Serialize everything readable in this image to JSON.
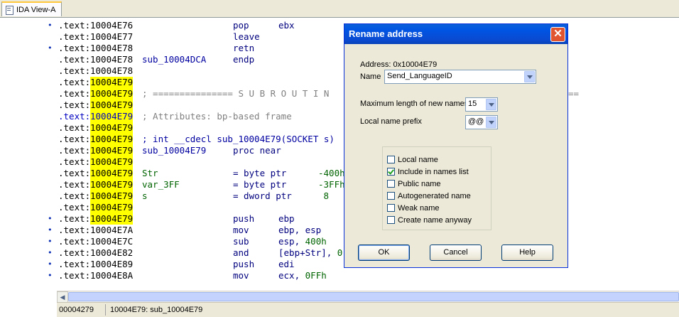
{
  "tab": {
    "title": "IDA View-A"
  },
  "listing": {
    "rows": [
      {
        "bullet": true,
        "seg": ".text:",
        "addr": "10004E76",
        "hl": false,
        "label": "",
        "op": "pop",
        "operand": "ebx",
        "comment": ""
      },
      {
        "bullet": false,
        "seg": ".text:",
        "addr": "10004E77",
        "hl": false,
        "label": "",
        "op": "leave",
        "operand": "",
        "comment": ""
      },
      {
        "bullet": true,
        "seg": ".text:",
        "addr": "10004E78",
        "hl": false,
        "label": "",
        "op": "retn",
        "operand": "",
        "comment": ""
      },
      {
        "bullet": false,
        "seg": ".text:",
        "addr": "10004E78",
        "hl": false,
        "label": "sub_10004DCA",
        "op": "endp",
        "operand": "",
        "comment": ""
      },
      {
        "bullet": false,
        "seg": ".text:",
        "addr": "10004E78",
        "hl": false,
        "label": "",
        "op": "",
        "operand": "",
        "comment": ""
      },
      {
        "bullet": false,
        "seg": ".text:",
        "addr": "10004E79",
        "hl": true,
        "label": "",
        "op": "",
        "operand": "",
        "comment": ""
      },
      {
        "bullet": false,
        "seg": ".text:",
        "addr": "10004E79",
        "hl": true,
        "label": "",
        "op": "",
        "operand": "",
        "comment": "; =============== S U B R O U T I N"
      },
      {
        "bullet": false,
        "seg": ".text:",
        "addr": "10004E79",
        "hl": true,
        "label": "",
        "op": "",
        "operand": "",
        "comment": ""
      },
      {
        "bullet": false,
        "seg": ".text:",
        "addr": "10004E79",
        "hl": true,
        "label": "",
        "op": "",
        "operand": "",
        "comment": "; Attributes: bp-based frame",
        "segblue": true
      },
      {
        "bullet": false,
        "seg": ".text:",
        "addr": "10004E79",
        "hl": true,
        "label": "",
        "op": "",
        "operand": "",
        "comment": ""
      },
      {
        "bullet": false,
        "seg": ".text:",
        "addr": "10004E79",
        "hl": true,
        "label": "",
        "op": "",
        "operand": "",
        "proto": "; int __cdecl sub_10004E79(SOCKET s)"
      },
      {
        "bullet": false,
        "seg": ".text:",
        "addr": "10004E79",
        "hl": true,
        "label": "sub_10004E79",
        "op": "proc near",
        "operand": "",
        "comment": ""
      },
      {
        "bullet": false,
        "seg": ".text:",
        "addr": "10004E79",
        "hl": true,
        "label": "",
        "op": "",
        "operand": "",
        "comment": ""
      },
      {
        "bullet": false,
        "seg": ".text:",
        "addr": "10004E79",
        "hl": true,
        "label": "Str",
        "labelg": true,
        "op": "= byte ptr",
        "operand": "-400h",
        "comment": ""
      },
      {
        "bullet": false,
        "seg": ".text:",
        "addr": "10004E79",
        "hl": true,
        "label": "var_3FF",
        "labelg": true,
        "op": "= byte ptr",
        "operand": "-3FFh",
        "comment": ""
      },
      {
        "bullet": false,
        "seg": ".text:",
        "addr": "10004E79",
        "hl": true,
        "label": "s",
        "labelg": true,
        "op": "= dword ptr",
        "operand": " 8",
        "comment": ""
      },
      {
        "bullet": false,
        "seg": ".text:",
        "addr": "10004E79",
        "hl": true,
        "label": "",
        "op": "",
        "operand": "",
        "comment": ""
      },
      {
        "bullet": true,
        "seg": ".text:",
        "addr": "10004E79",
        "hl": true,
        "label": "",
        "op": "push",
        "operand": "ebp",
        "comment": ""
      },
      {
        "bullet": true,
        "seg": ".text:",
        "addr": "10004E7A",
        "hl": false,
        "label": "",
        "op": "mov",
        "operand": "ebp, esp",
        "comment": ""
      },
      {
        "bullet": true,
        "seg": ".text:",
        "addr": "10004E7C",
        "hl": false,
        "label": "",
        "op": "sub",
        "operand": "esp, 400h",
        "comment": ""
      },
      {
        "bullet": true,
        "seg": ".text:",
        "addr": "10004E82",
        "hl": false,
        "label": "",
        "op": "and",
        "operand": "[ebp+Str], 0",
        "comment": ""
      },
      {
        "bullet": true,
        "seg": ".text:",
        "addr": "10004E89",
        "hl": false,
        "label": "",
        "op": "push",
        "operand": "edi",
        "comment": ""
      },
      {
        "bullet": true,
        "seg": ".text:",
        "addr": "10004E8A",
        "hl": false,
        "label": "",
        "op": "mov",
        "operand": "ecx, 0FFh",
        "comment": ""
      }
    ],
    "eq_tail": "=="
  },
  "status": {
    "offset": "00004279",
    "location": "10004E79: sub_10004E79"
  },
  "dialog": {
    "title": "Rename address",
    "address_label": "Address: 0x10004E79",
    "name_label": "Name",
    "name_value": "Send_LanguageID",
    "maxlen_label": "Maximum length of new names",
    "maxlen_value": "15",
    "prefix_label": "Local name prefix",
    "prefix_value": "@@",
    "checkboxes": [
      {
        "label": "Local name",
        "checked": false
      },
      {
        "label": "Include in names list",
        "checked": true
      },
      {
        "label": "Public name",
        "checked": false
      },
      {
        "label": "Autogenerated name",
        "checked": false
      },
      {
        "label": "Weak name",
        "checked": false
      },
      {
        "label": "Create name anyway",
        "checked": false
      }
    ],
    "ok_label": "OK",
    "cancel_label": "Cancel",
    "help_label": "Help"
  }
}
